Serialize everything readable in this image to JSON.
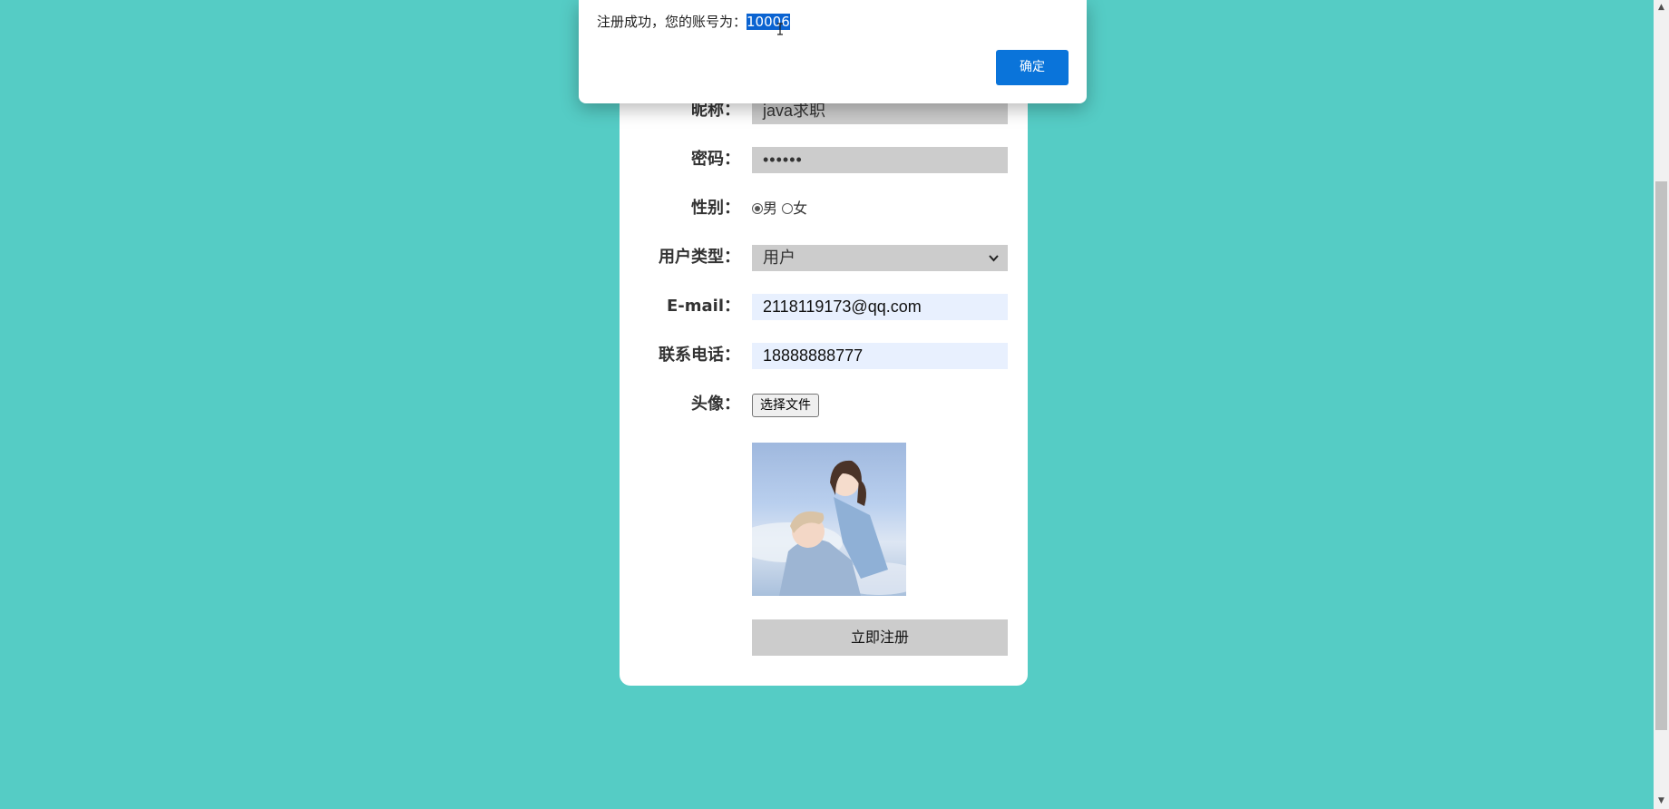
{
  "dialog": {
    "message": "注册成功，您的账号为：",
    "account": "10006",
    "ok_label": "确定"
  },
  "form": {
    "nickname": {
      "label": "昵称：",
      "value": "java求职"
    },
    "password": {
      "label": "密码：",
      "value": "••••••"
    },
    "gender": {
      "label": "性别：",
      "options": [
        "男",
        "女"
      ],
      "selected": "男"
    },
    "user_type": {
      "label": "用户类型：",
      "value": "用户"
    },
    "email": {
      "label": "E-mail：",
      "value": "2118119173@qq.com"
    },
    "phone": {
      "label": "联系电话：",
      "value": "18888888777"
    },
    "avatar": {
      "label": "头像：",
      "file_button": "选择文件"
    },
    "submit_label": "立即注册"
  },
  "icons": {
    "select_arrow": "chevron-down-icon",
    "cursor": "text-cursor-icon"
  },
  "colors": {
    "background": "#55ccc5",
    "card": "#ffffff",
    "field_gray": "#cccccc",
    "field_autofill": "#e8f0fe",
    "primary_button": "#0a74da"
  }
}
